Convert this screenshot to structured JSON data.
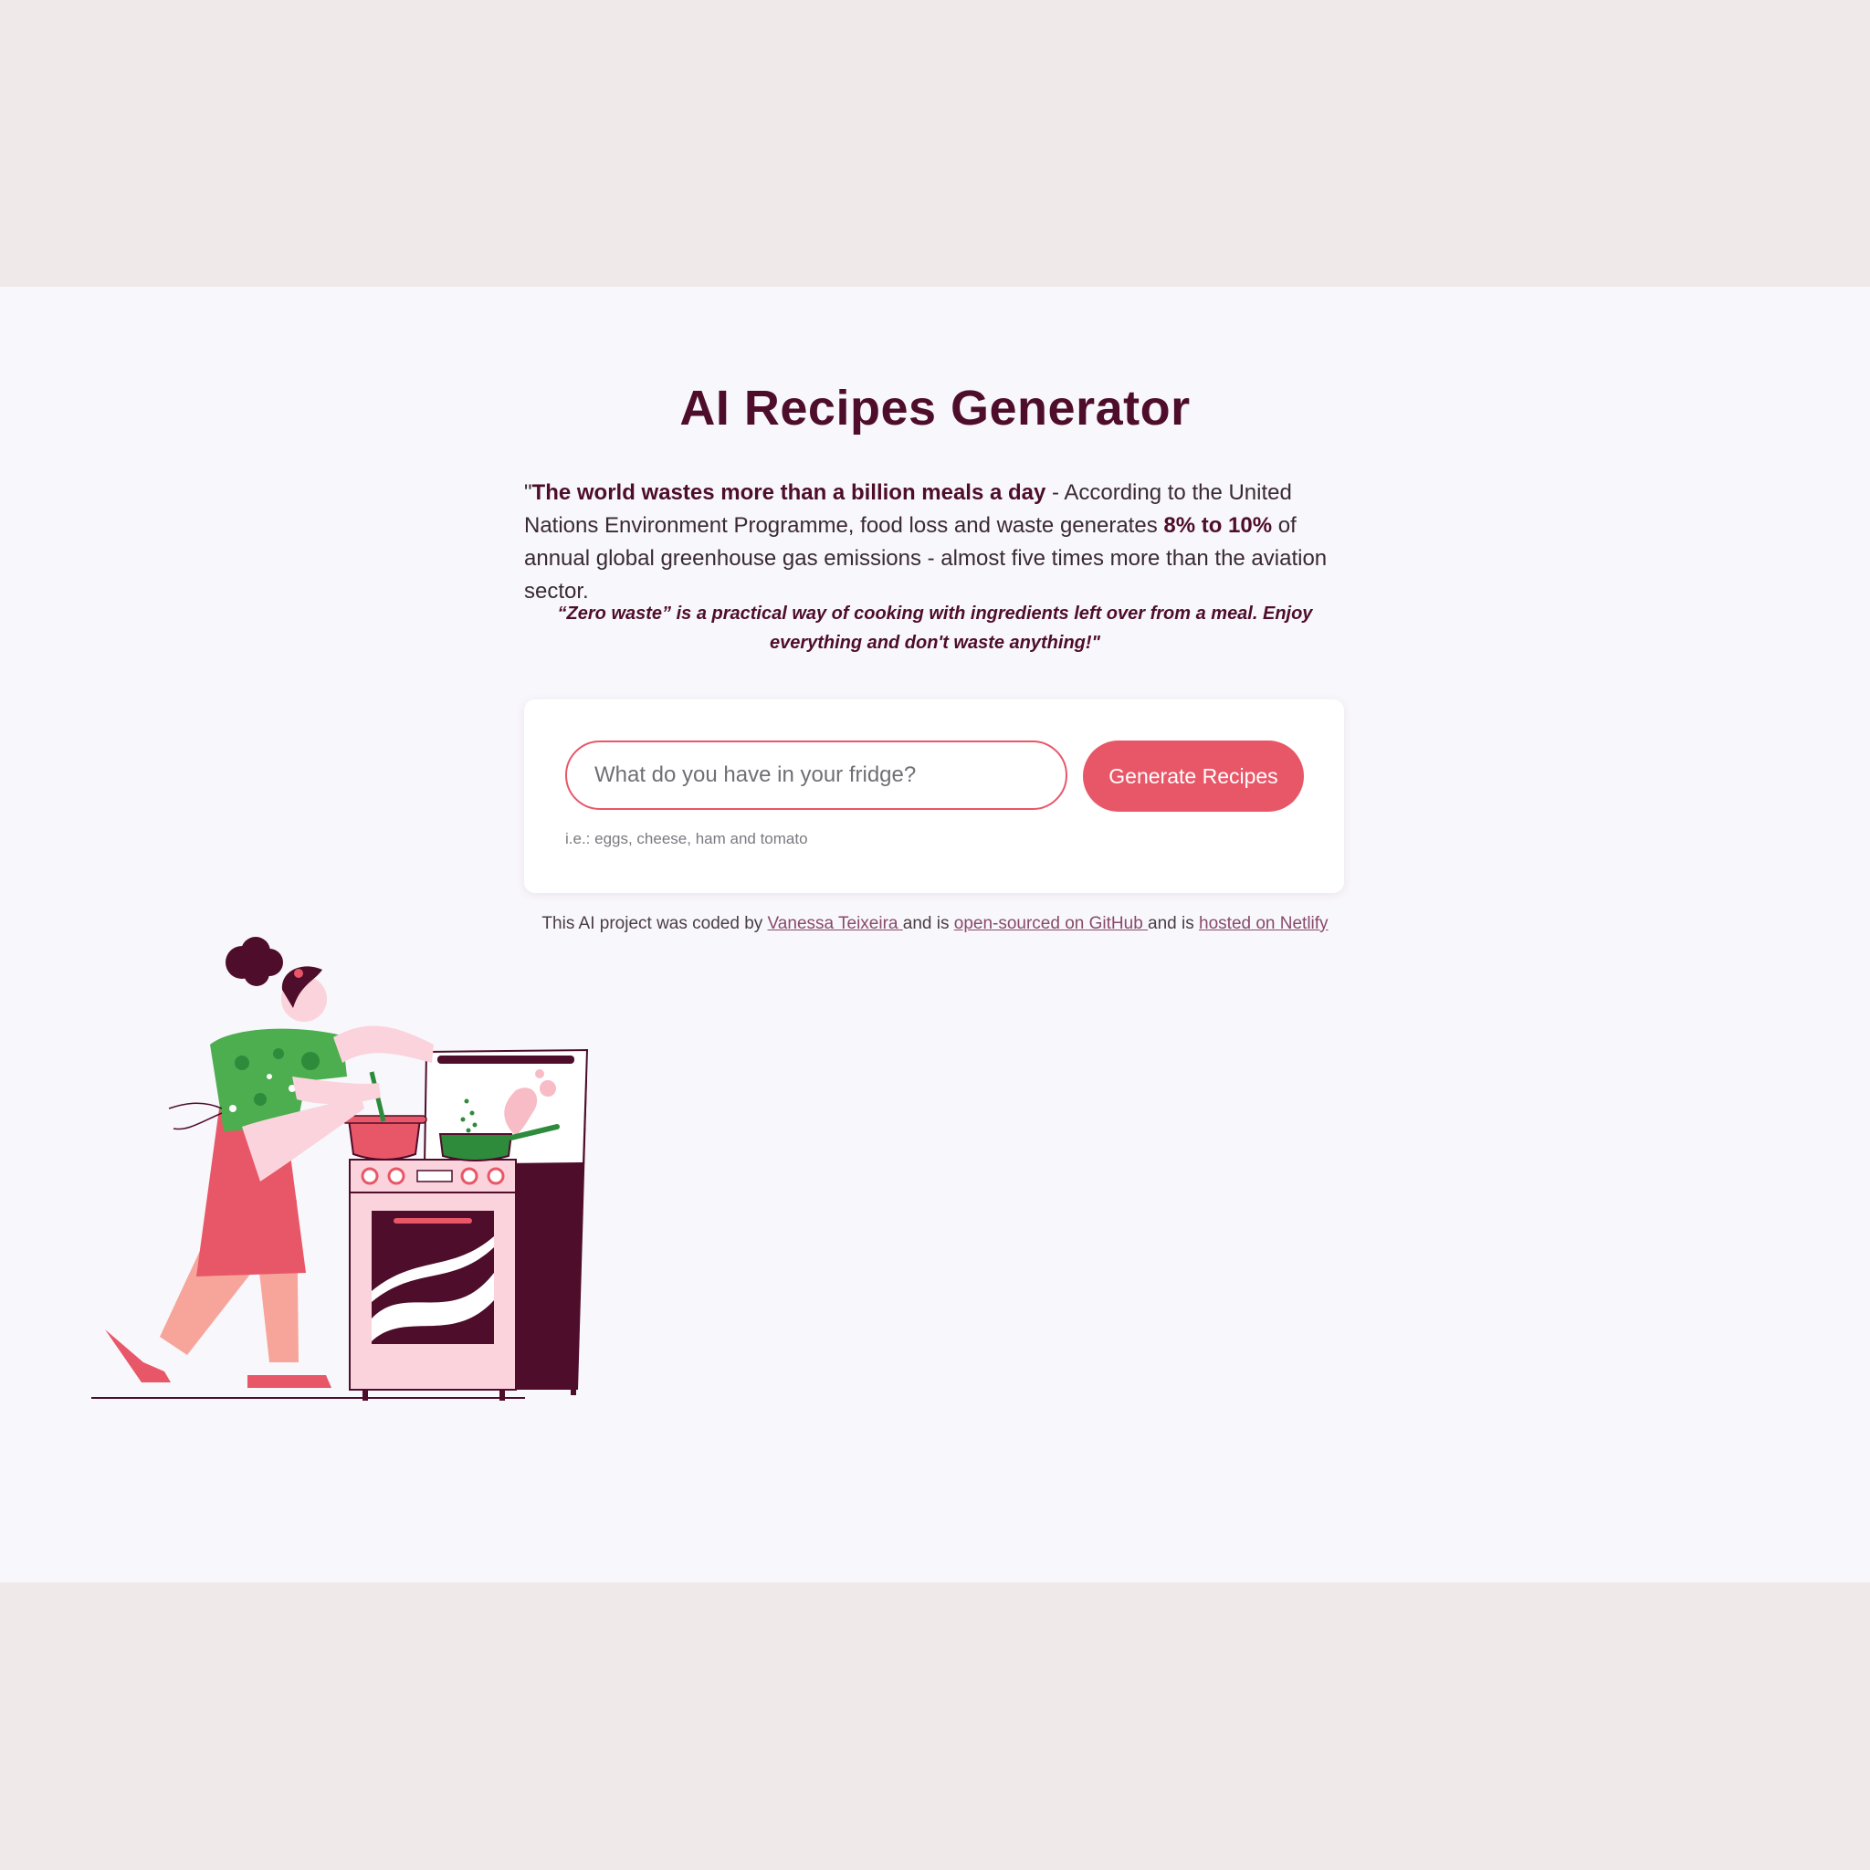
{
  "app": {
    "title": "AI Recipes Generator"
  },
  "intro": {
    "open_quote": "\"",
    "bold_lead": "The world wastes more than a billion meals a day",
    "text_1": " - According to the United Nations Environment Programme, food loss and waste generates ",
    "bold_stat": "8% to 10%",
    "text_2": " of annual global greenhouse gas emissions - almost five times more than the aviation sector."
  },
  "quote": "“Zero waste” is a practical way of cooking with ingredients left over from a meal. Enjoy everything and don't waste anything!\"",
  "form": {
    "placeholder": "What do you have in your fridge?",
    "value": "",
    "button_label": "Generate Recipes",
    "hint": "i.e.: eggs, cheese, ham and tomato"
  },
  "footer": {
    "text_1": "This AI project was coded by ",
    "link_author": "Vanessa Teixeira ",
    "text_2": "and is ",
    "link_github": "open-sourced on GitHub ",
    "text_3": "and is ",
    "link_netlify": "hosted on Netlify"
  },
  "colors": {
    "page_bg": "#efe9e9",
    "content_bg": "#f8f7fc",
    "accent": "#e85768",
    "heading": "#4e0d2b",
    "link": "#884a6b"
  }
}
